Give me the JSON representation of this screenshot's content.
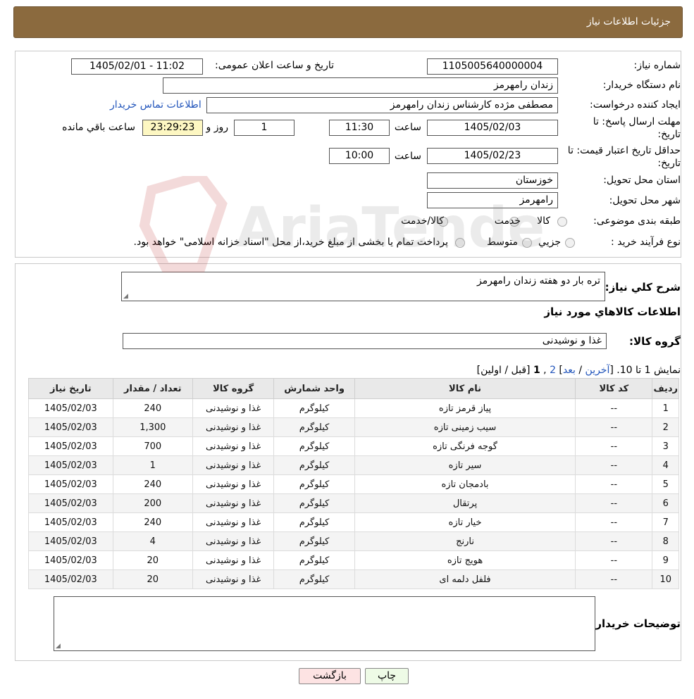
{
  "header": {
    "title": "جزئیات اطلاعات نیاز"
  },
  "form": {
    "need_number_label": "شماره نیاز:",
    "need_number": "1105005640000004",
    "announce_label": "تاریخ و ساعت اعلان عمومی:",
    "announce_value": "1405/02/01 - 11:02",
    "buyer_org_label": "نام دستگاه خریدار:",
    "buyer_org": "زندان رامهرمز",
    "creator_label": "ایجاد کننده درخواست:",
    "creator": "مصطفی مژده کارشناس زندان رامهرمز",
    "contact_link": "اطلاعات تماس خریدار",
    "deadline_label_1": "مهلت ارسال پاسخ: تا",
    "deadline_label_2": "تاریخ:",
    "deadline_date": "1405/02/03",
    "time_label": "ساعت",
    "deadline_time": "11:30",
    "days_value": "1",
    "days_label": "روز و",
    "remaining_time": "23:29:23",
    "remaining_label": "ساعت باقي مانده",
    "validity_label_1": "حداقل تاریخ اعتبار قیمت: تا",
    "validity_label_2": "تاریخ:",
    "validity_date": "1405/02/23",
    "validity_time": "10:00",
    "province_label": "استان محل تحویل:",
    "province": "خوزستان",
    "city_label": "شهر محل تحویل:",
    "city": "رامهرمز",
    "category_label": "طبقه بندی موضوعی:",
    "category_options": [
      "کالا",
      "خدمت",
      "کالا/خدمت"
    ],
    "process_label": "نوع فرآیند خرید :",
    "process_options": [
      "جزیي",
      "متوسط"
    ],
    "process_note": "پرداخت تمام یا بخشی از مبلغ خرید،از محل \"اسناد خزانه اسلامی\" خواهد بود."
  },
  "details": {
    "desc_label": "شرح كلي نياز:",
    "desc_value": "تره بار دو هفته زندان رامهرمز",
    "items_heading": "اطلاعات كالاهاي مورد نياز",
    "group_label": "گروه کالا:",
    "group_value": "غذا و نوشیدنی",
    "pagination": {
      "prefix": "نمایش 1 تا 10. [",
      "last": "آخرین",
      "sep1": " / ",
      "next": "بعد",
      "sep2": "] ",
      "page2": "2",
      "comma": " ,",
      "page1": "1",
      "suffix": " [قبل / اولین]"
    },
    "columns": [
      "ردیف",
      "کد کالا",
      "نام کالا",
      "واحد شمارش",
      "گروه کالا",
      "تعداد / مقدار",
      "تاریخ نیاز"
    ],
    "rows": [
      [
        "1",
        "--",
        "پیاز قرمز تازه",
        "کیلوگرم",
        "غذا و نوشیدنی",
        "240",
        "1405/02/03"
      ],
      [
        "2",
        "--",
        "سیب زمینی تازه",
        "کیلوگرم",
        "غذا و نوشیدنی",
        "1,300",
        "1405/02/03"
      ],
      [
        "3",
        "--",
        "گوجه فرنگی تازه",
        "کیلوگرم",
        "غذا و نوشیدنی",
        "700",
        "1405/02/03"
      ],
      [
        "4",
        "--",
        "سیر تازه",
        "کیلوگرم",
        "غذا و نوشیدنی",
        "1",
        "1405/02/03"
      ],
      [
        "5",
        "--",
        "بادمجان تازه",
        "کیلوگرم",
        "غذا و نوشیدنی",
        "240",
        "1405/02/03"
      ],
      [
        "6",
        "--",
        "پرتقال",
        "کیلوگرم",
        "غذا و نوشیدنی",
        "200",
        "1405/02/03"
      ],
      [
        "7",
        "--",
        "خیار تازه",
        "کیلوگرم",
        "غذا و نوشیدنی",
        "240",
        "1405/02/03"
      ],
      [
        "8",
        "--",
        "نارنج",
        "کیلوگرم",
        "غذا و نوشیدنی",
        "4",
        "1405/02/03"
      ],
      [
        "9",
        "--",
        "هویج تازه",
        "کیلوگرم",
        "غذا و نوشیدنی",
        "20",
        "1405/02/03"
      ],
      [
        "10",
        "--",
        "فلفل دلمه ای",
        "کیلوگرم",
        "غذا و نوشیدنی",
        "20",
        "1405/02/03"
      ]
    ],
    "buyer_notes_label": "توضیحات خریدار:",
    "buyer_notes_value": ""
  },
  "buttons": {
    "print": "چاپ",
    "back": "بازگشت"
  },
  "watermark": {
    "text": "AriaTender.neT"
  },
  "colors": {
    "header_bg": "#8b6a3e",
    "link": "#2255bb",
    "print_bg": "#eefbe6",
    "back_bg": "#fde3e3",
    "remaining_bg": "#fdf7c2"
  }
}
